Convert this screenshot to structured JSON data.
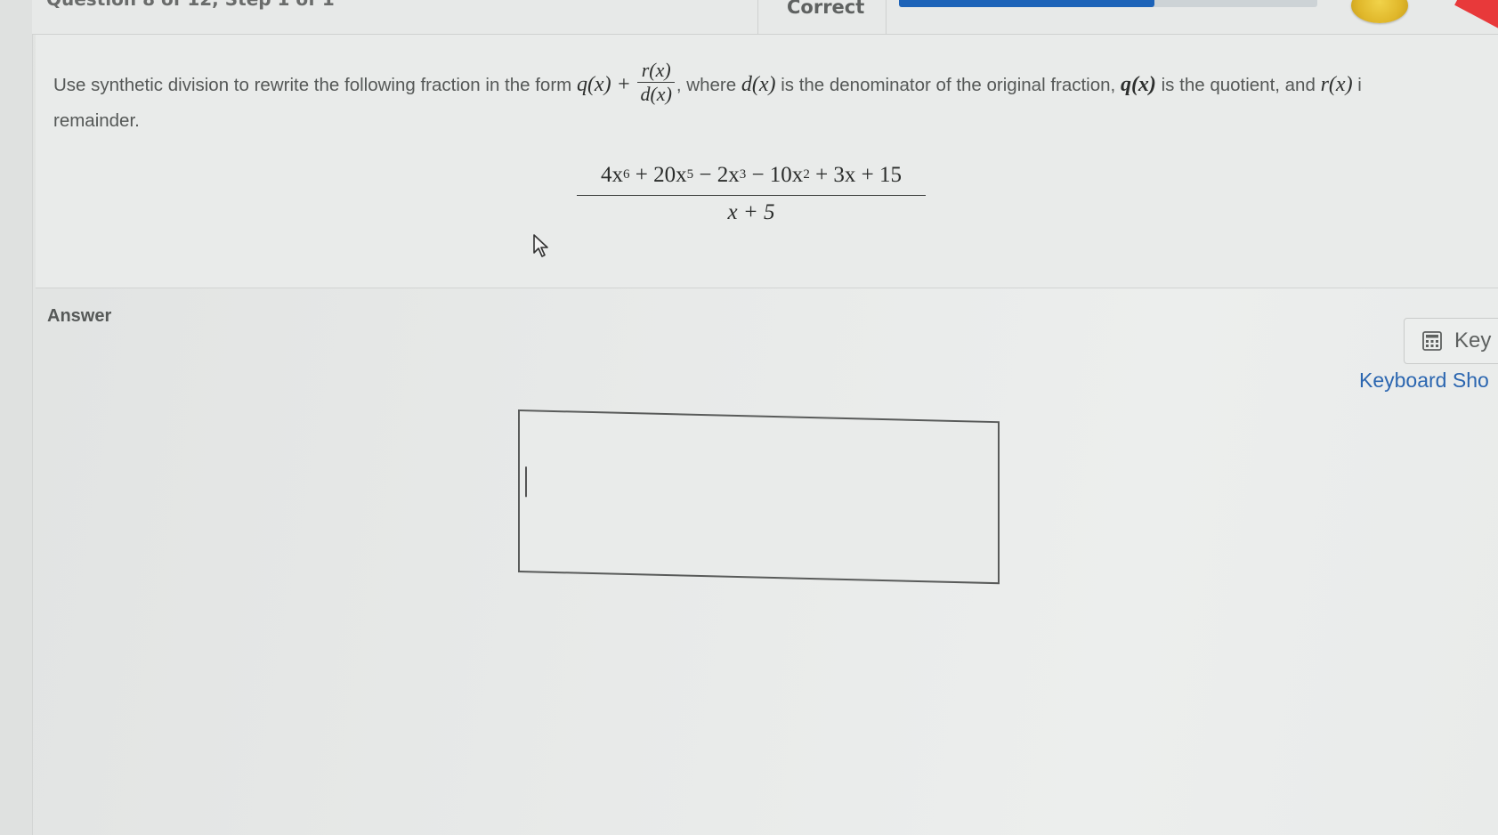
{
  "header": {
    "question_counter": "Question 8 of 12, Step 1 of 1",
    "status": "Correct",
    "progress_fraction": 0.61,
    "colors": {
      "progress_fill": "#1d63b8",
      "progress_track": "#cdd3d6",
      "coin": "#e0b72a",
      "corner_accent": "#e8393a"
    },
    "icons": [
      "coin-icon"
    ]
  },
  "question": {
    "prompt_part1": "Use synthetic division to rewrite the following fraction in the form",
    "prompt_q": "q(x) +",
    "prompt_frac_num": "r(x)",
    "prompt_frac_den": "d(x)",
    "prompt_part2": ", where",
    "prompt_d": "d(x)",
    "prompt_part3": "is the denominator of the original fraction,",
    "prompt_q2": "q(x)",
    "prompt_part4": "is the quotient, and",
    "prompt_r": "r(x)",
    "prompt_part5": "i",
    "prompt_line2": "remainder.",
    "fraction": {
      "numerator": {
        "t1_coef": "4x",
        "t1_exp": "6",
        "t2_coef": "+ 20x",
        "t2_exp": "5",
        "t3_coef": "− 2x",
        "t3_exp": "3",
        "t4_coef": "− 10x",
        "t4_exp": "2",
        "rest": "+ 3x + 15"
      },
      "denominator": "x + 5"
    }
  },
  "answer": {
    "label": "Answer",
    "input_value": "",
    "keypad_label": "Key",
    "shortcuts_label": "Keyboard Sho"
  }
}
